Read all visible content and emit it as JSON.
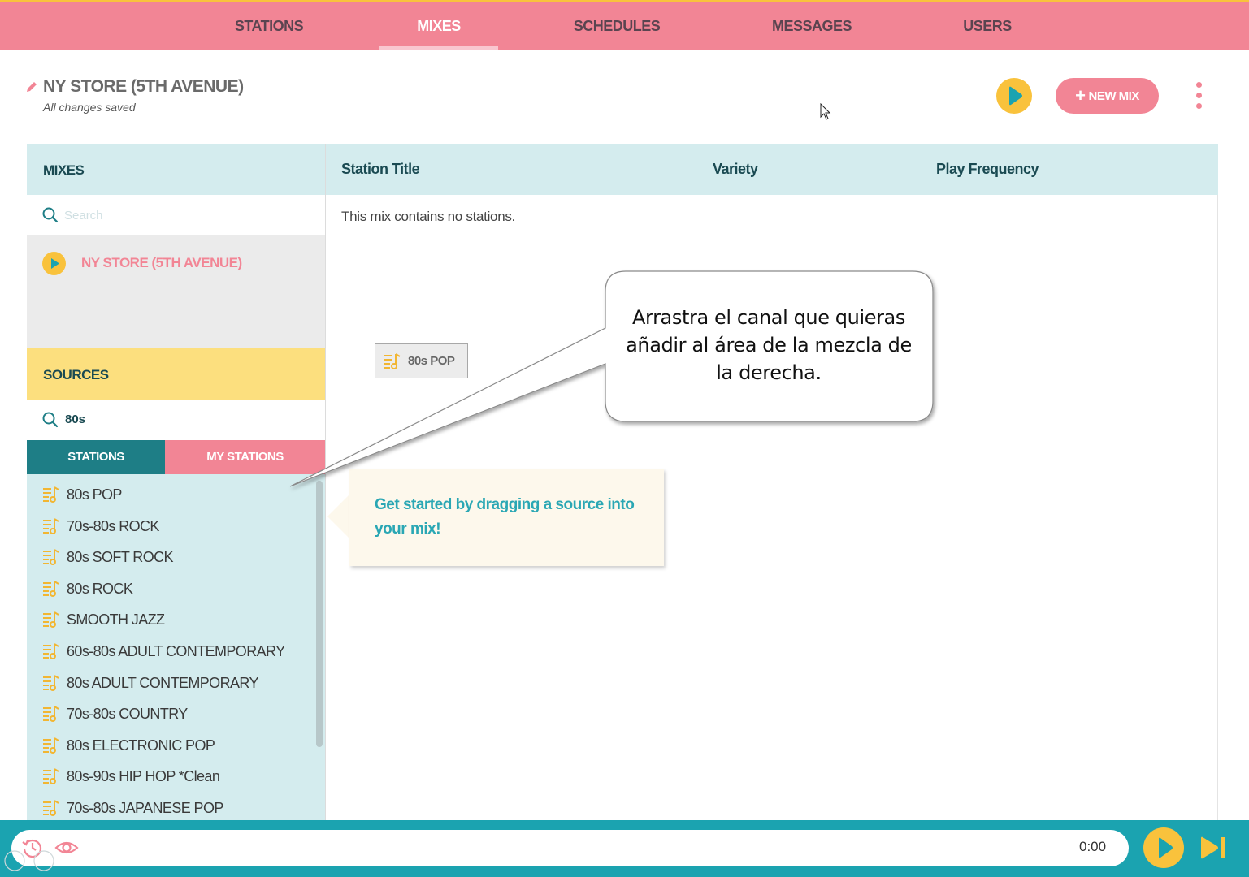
{
  "nav": {
    "tabs": [
      {
        "label": "STATIONS"
      },
      {
        "label": "MIXES"
      },
      {
        "label": "SCHEDULES"
      },
      {
        "label": "MESSAGES"
      },
      {
        "label": "USERS"
      }
    ],
    "active": "MIXES"
  },
  "header": {
    "title": "NY STORE (5TH AVENUE)",
    "status": "All changes saved",
    "new_mix_label": "NEW MIX"
  },
  "mixes": {
    "heading": "MIXES",
    "search_placeholder": "Search",
    "items": [
      {
        "label": "NY STORE (5TH AVENUE)"
      }
    ]
  },
  "sources": {
    "heading": "SOURCES",
    "search_value": "80s",
    "tabs": {
      "stations": "STATIONS",
      "my_stations": "MY STATIONS"
    },
    "active_tab": "STATIONS",
    "items": [
      {
        "label": "80s POP"
      },
      {
        "label": "70s-80s ROCK"
      },
      {
        "label": "80s SOFT ROCK"
      },
      {
        "label": "80s ROCK"
      },
      {
        "label": "SMOOTH JAZZ"
      },
      {
        "label": "60s-80s ADULT CONTEMPORARY"
      },
      {
        "label": "80s ADULT CONTEMPORARY"
      },
      {
        "label": "70s-80s COUNTRY"
      },
      {
        "label": "80s ELECTRONIC POP"
      },
      {
        "label": "80s-90s HIP HOP *Clean"
      },
      {
        "label": "70s-80s JAPANESE POP"
      }
    ]
  },
  "mix_table": {
    "columns": {
      "title": "Station Title",
      "variety": "Variety",
      "frequency": "Play Frequency"
    },
    "empty_message": "This mix contains no stations."
  },
  "drag_ghost": {
    "label": "80s POP"
  },
  "tooltip": {
    "text": "Get started by dragging a source into your mix!"
  },
  "callout": {
    "text": "Arrastra el canal que quieras añadir al área de la mezcla de la derecha."
  },
  "player": {
    "time": "0:00"
  },
  "icons": {
    "title_edit": "pencil-icon",
    "play": "play-icon",
    "new_mix": "plus-icon",
    "menu": "kebab-menu-icon",
    "search": "search-icon",
    "playlist": "playlist-music-icon",
    "history": "history-icon",
    "preview": "eye-icon",
    "skip": "skip-next-icon"
  },
  "colors": {
    "brand_pink": "#f28595",
    "brand_yellow": "#f9c23c",
    "brand_teal": "#1ba3b0",
    "dark_teal": "#1e7e86",
    "panel_light": "#d4ecee",
    "sources_yellow": "#fcdf7e"
  }
}
